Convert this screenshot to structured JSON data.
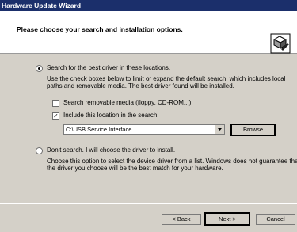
{
  "window": {
    "title": "Hardware Update Wizard"
  },
  "header": {
    "title": "Please choose your search and installation options."
  },
  "options": {
    "search_label": "Search for the best driver in these locations.",
    "search_desc": [
      "Use the check boxes below to limit or expand the default search, which includes local",
      "paths and removable media. The best driver found will be installed."
    ],
    "removable_label": "Search removable media (floppy, CD-ROM...)",
    "removable_checked": false,
    "include_label": "Include this location in the search:",
    "include_checked": true,
    "location_value": "C:\\USB Service Interface",
    "browse_label": "Browse",
    "dont_search_label": "Don't search. I will choose the driver to install.",
    "dont_search_desc": [
      "Choose this option to select the device driver from a list.  Windows does not guarantee that",
      "the driver you choose will be the best match for your hardware."
    ]
  },
  "footer": {
    "back_label": "< Back",
    "next_label": "Next >",
    "cancel_label": "Cancel"
  }
}
